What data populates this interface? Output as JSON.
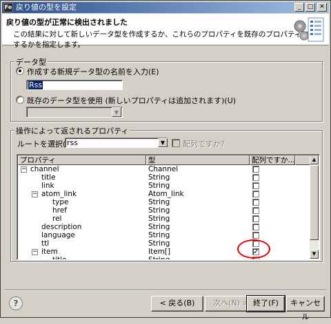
{
  "window": {
    "title": "戻り値の型を設定",
    "app_icon": "Fe"
  },
  "header": {
    "title": "戻り値の型が正常に検出されました",
    "description": "この結果に対して新しいデータ型を作成するか、これらのプロパティを既存のプロパティに結合するかを指定します。",
    "graphic": "wizard-gears-graphic"
  },
  "datatype_group": {
    "label": "データ型",
    "create_new_label": "作成する新規データ型の名前を入力(E)",
    "create_new_checked": true,
    "new_name_value": "Rss",
    "use_existing_label": "既存のデータ型を使用 (新しいプロパティは追加されます)(U)",
    "use_existing_checked": false,
    "existing_select_value": ""
  },
  "props_group": {
    "label": "操作によって返されるプロパティ",
    "root_label": "ルートを選択(R):",
    "root_value": "rss",
    "is_array_label": "配列ですか?",
    "columns": [
      "プロパティ",
      "型",
      "配列ですか..."
    ],
    "rows": [
      {
        "name": "channel",
        "type": "Channel",
        "depth": 0,
        "expander": "−",
        "checked": false
      },
      {
        "name": "title",
        "type": "String",
        "depth": 1,
        "expander": "",
        "checked": false
      },
      {
        "name": "link",
        "type": "String",
        "depth": 1,
        "expander": "",
        "checked": false
      },
      {
        "name": "atom_link",
        "type": "Atom_link",
        "depth": 1,
        "expander": "−",
        "checked": false
      },
      {
        "name": "type",
        "type": "String",
        "depth": 2,
        "expander": "",
        "checked": false
      },
      {
        "name": "href",
        "type": "String",
        "depth": 2,
        "expander": "",
        "checked": false
      },
      {
        "name": "rel",
        "type": "String",
        "depth": 2,
        "expander": "",
        "checked": false
      },
      {
        "name": "description",
        "type": "String",
        "depth": 1,
        "expander": "",
        "checked": false
      },
      {
        "name": "language",
        "type": "String",
        "depth": 1,
        "expander": "",
        "checked": false
      },
      {
        "name": "ttl",
        "type": "String",
        "depth": 1,
        "expander": "",
        "checked": false
      },
      {
        "name": "item",
        "type": "Item[]",
        "depth": 1,
        "expander": "−",
        "checked": true
      },
      {
        "name": "title",
        "type": "String",
        "depth": 2,
        "expander": "",
        "checked": false
      }
    ]
  },
  "buttons": {
    "back": "< 戻る(B)",
    "next": "次へ(N) >",
    "finish": "終了(F)",
    "cancel": "キャンセル"
  },
  "colors": {
    "highlight_circle": "#e00000",
    "selection": "#0a246a"
  }
}
